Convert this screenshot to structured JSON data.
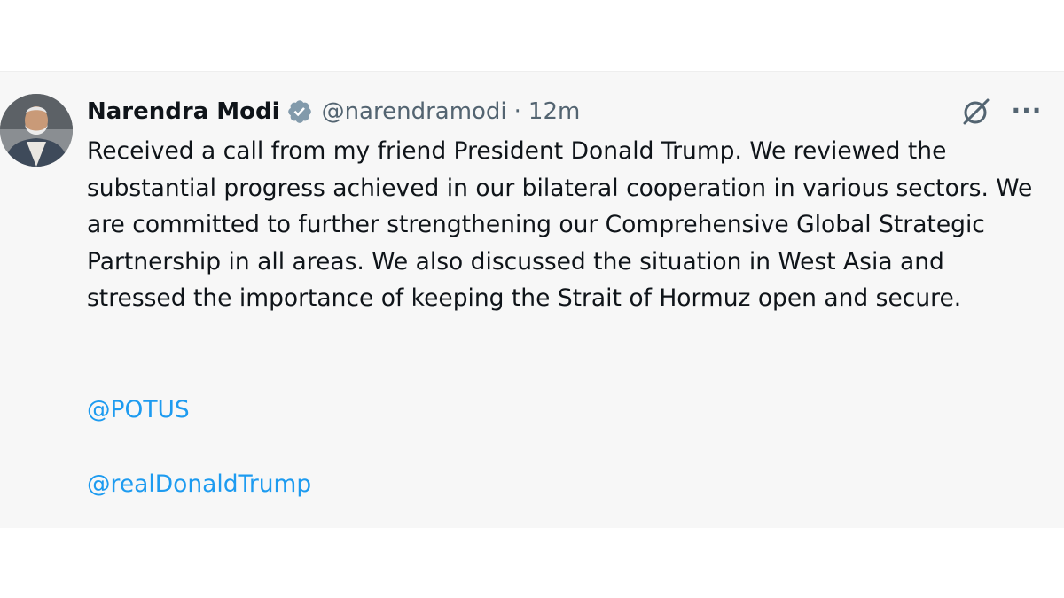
{
  "tweet": {
    "author_name": "Narendra Modi",
    "handle": "@narendramodi",
    "separator": "·",
    "time_ago": "12m",
    "verified_icon": "verified-badge-icon",
    "body": "Received a call from my friend President Donald Trump. We reviewed the substantial progress achieved in our bilateral cooperation in various sectors. We are committed to further strengthening our Comprehensive Global Strategic Partnership in all areas. We also discussed the situation in West Asia and stressed the importance of keeping the Strait of Hormuz open and secure.",
    "mentions": [
      "@POTUS",
      "@realDonaldTrump"
    ],
    "more_label": "···"
  },
  "colors": {
    "background": "#f7f7f7",
    "text": "#0f1419",
    "muted": "#536471",
    "link": "#1d9bf0",
    "verified": "#829aab"
  }
}
